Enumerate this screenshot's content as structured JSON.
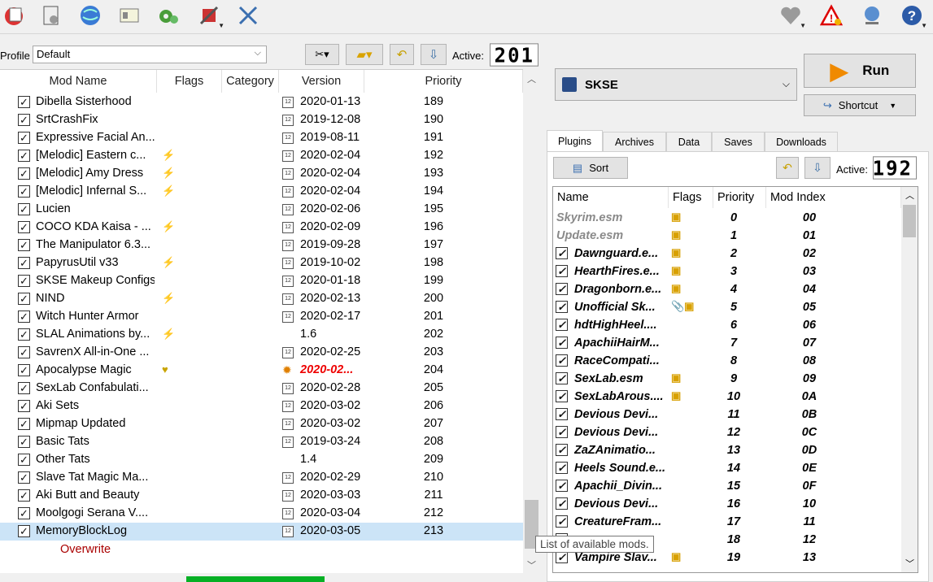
{
  "toolbar": {
    "icons": [
      "install-mod-icon",
      "nexus-icon",
      "web-icon",
      "profiles-icon",
      "settings-icon",
      "tools-icon",
      "wrench-icon"
    ],
    "right_icons": [
      "endorse-icon",
      "warning-icon",
      "update-icon",
      "help-icon"
    ]
  },
  "profile": {
    "label": "Profile",
    "value": "Default",
    "active_label": "Active:",
    "active_count": "201"
  },
  "modlist": {
    "headers": {
      "name": "Mod Name",
      "flags": "Flags",
      "category": "Category",
      "version": "Version",
      "priority": "Priority"
    },
    "rows": [
      {
        "name": "Dibella Sisterhood",
        "version": "2020-01-13",
        "priority": "189",
        "flag": "",
        "cal": true
      },
      {
        "name": "SrtCrashFix",
        "version": "2019-12-08",
        "priority": "190",
        "flag": "",
        "cal": true
      },
      {
        "name": "Expressive Facial An...",
        "version": "2019-08-11",
        "priority": "191",
        "flag": "",
        "cal": true
      },
      {
        "name": "[Melodic] Eastern c...",
        "version": "2020-02-04",
        "priority": "192",
        "flag": "⚡",
        "cal": true
      },
      {
        "name": "[Melodic] Amy Dress",
        "version": "2020-02-04",
        "priority": "193",
        "flag": "⚡",
        "cal": true
      },
      {
        "name": "[Melodic] Infernal S...",
        "version": "2020-02-04",
        "priority": "194",
        "flag": "⚡",
        "cal": true
      },
      {
        "name": "Lucien",
        "version": "2020-02-06",
        "priority": "195",
        "flag": "",
        "cal": true
      },
      {
        "name": "COCO KDA Kaisa - ...",
        "version": "2020-02-09",
        "priority": "196",
        "flag": "⚡",
        "cal": true
      },
      {
        "name": "The Manipulator 6.3...",
        "version": "2019-09-28",
        "priority": "197",
        "flag": "",
        "cal": true
      },
      {
        "name": "PapyrusUtil v33",
        "version": "2019-10-02",
        "priority": "198",
        "flag": "⚡",
        "cal": true
      },
      {
        "name": "SKSE Makeup Configs",
        "version": "2020-01-18",
        "priority": "199",
        "flag": "",
        "cal": true
      },
      {
        "name": "NIND",
        "version": "2020-02-13",
        "priority": "200",
        "flag": "⚡",
        "cal": true
      },
      {
        "name": "Witch Hunter Armor",
        "version": "2020-02-17",
        "priority": "201",
        "flag": "",
        "cal": true
      },
      {
        "name": "SLAL Animations by...",
        "version": "1.6",
        "priority": "202",
        "flag": "⚡",
        "cal": false
      },
      {
        "name": "SavrenX All-in-One ...",
        "version": "2020-02-25",
        "priority": "203",
        "flag": "",
        "cal": true
      },
      {
        "name": "Apocalypse Magic",
        "version": "2020-02...",
        "priority": "204",
        "flag": "♥",
        "cal": false,
        "red": true
      },
      {
        "name": "SexLab Confabulati...",
        "version": "2020-02-28",
        "priority": "205",
        "flag": "",
        "cal": true
      },
      {
        "name": "Aki Sets",
        "version": "2020-03-02",
        "priority": "206",
        "flag": "",
        "cal": true
      },
      {
        "name": "Mipmap Updated",
        "version": "2020-03-02",
        "priority": "207",
        "flag": "",
        "cal": true
      },
      {
        "name": "Basic Tats",
        "version": "2019-03-24",
        "priority": "208",
        "flag": "",
        "cal": true
      },
      {
        "name": "Other Tats",
        "version": "1.4",
        "priority": "209",
        "flag": "",
        "cal": false
      },
      {
        "name": "Slave Tat Magic Ma...",
        "version": "2020-02-29",
        "priority": "210",
        "flag": "",
        "cal": true
      },
      {
        "name": "Aki Butt and Beauty",
        "version": "2020-03-03",
        "priority": "211",
        "flag": "",
        "cal": true
      },
      {
        "name": "Moolgogi Serana V....",
        "version": "2020-03-04",
        "priority": "212",
        "flag": "",
        "cal": true
      },
      {
        "name": "MemoryBlockLog",
        "version": "2020-03-05",
        "priority": "213",
        "flag": "",
        "cal": true,
        "selected": true
      }
    ],
    "overwrite": "Overwrite"
  },
  "tooltip": "List of available mods.",
  "executable": {
    "selected": "SKSE",
    "run": "Run",
    "shortcut": "Shortcut"
  },
  "tabs": [
    "Plugins",
    "Archives",
    "Data",
    "Saves",
    "Downloads"
  ],
  "plugins": {
    "sort": "Sort",
    "active_label": "Active:",
    "active_count": "192",
    "headers": {
      "name": "Name",
      "flags": "Flags",
      "priority": "Priority",
      "index": "Mod Index"
    },
    "rows": [
      {
        "name": "Skyrim.esm",
        "priority": "0",
        "index": "00",
        "grey": true,
        "flag": "▣"
      },
      {
        "name": "Update.esm",
        "priority": "1",
        "index": "01",
        "grey": true,
        "flag": "▣"
      },
      {
        "name": "Dawnguard.e...",
        "priority": "2",
        "index": "02",
        "flag": "▣"
      },
      {
        "name": "HearthFires.e...",
        "priority": "3",
        "index": "03",
        "flag": "▣"
      },
      {
        "name": "Dragonborn.e...",
        "priority": "4",
        "index": "04",
        "flag": "▣"
      },
      {
        "name": "Unofficial Sk...",
        "priority": "5",
        "index": "05",
        "flag": "📎▣"
      },
      {
        "name": "hdtHighHeel....",
        "priority": "6",
        "index": "06",
        "flag": ""
      },
      {
        "name": "ApachiiHairM...",
        "priority": "7",
        "index": "07",
        "flag": ""
      },
      {
        "name": "RaceCompati...",
        "priority": "8",
        "index": "08",
        "flag": ""
      },
      {
        "name": "SexLab.esm",
        "priority": "9",
        "index": "09",
        "flag": "▣"
      },
      {
        "name": "SexLabArous....",
        "priority": "10",
        "index": "0A",
        "flag": "▣"
      },
      {
        "name": "Devious Devi...",
        "priority": "11",
        "index": "0B",
        "flag": ""
      },
      {
        "name": "Devious Devi...",
        "priority": "12",
        "index": "0C",
        "flag": ""
      },
      {
        "name": "ZaZAnimatio...",
        "priority": "13",
        "index": "0D",
        "flag": ""
      },
      {
        "name": "Heels Sound.e...",
        "priority": "14",
        "index": "0E",
        "flag": ""
      },
      {
        "name": "Apachii_Divin...",
        "priority": "15",
        "index": "0F",
        "flag": ""
      },
      {
        "name": "Devious Devi...",
        "priority": "16",
        "index": "10",
        "flag": ""
      },
      {
        "name": "CreatureFram...",
        "priority": "17",
        "index": "11",
        "flag": ""
      },
      {
        "name": "",
        "priority": "18",
        "index": "12",
        "flag": ""
      },
      {
        "name": "Vampire Slav...",
        "priority": "19",
        "index": "13",
        "flag": "▣"
      }
    ]
  }
}
